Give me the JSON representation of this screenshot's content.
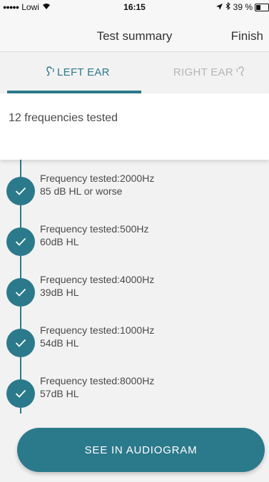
{
  "status_bar": {
    "carrier": "Lowi",
    "time": "16:15",
    "battery": "39 %"
  },
  "nav": {
    "title": "Test summary",
    "finish_label": "Finish"
  },
  "tabs": {
    "left_label": "LEFT EAR",
    "right_label": "RIGHT EAR",
    "active": "left"
  },
  "summary": {
    "text": "12 frequencies tested"
  },
  "frequencies": [
    {
      "line1": "Frequency tested:2000Hz",
      "line2": "85 dB HL or worse"
    },
    {
      "line1": "Frequency tested:500Hz",
      "line2": "60dB HL"
    },
    {
      "line1": "Frequency tested:4000Hz",
      "line2": "39dB HL"
    },
    {
      "line1": "Frequency tested:1000Hz",
      "line2": "54dB HL"
    },
    {
      "line1": "Frequency tested:8000Hz",
      "line2": "57dB HL"
    }
  ],
  "cta": {
    "label": "SEE IN AUDIOGRAM"
  },
  "colors": {
    "accent": "#2b7a8b"
  },
  "icons": {
    "status": [
      "signal-dots-icon",
      "wifi-icon",
      "location-arrow-icon",
      "bluetooth-icon",
      "battery-icon"
    ],
    "tabs": [
      "left-ear-icon",
      "right-ear-icon"
    ],
    "timeline": "checkmark-icon"
  }
}
